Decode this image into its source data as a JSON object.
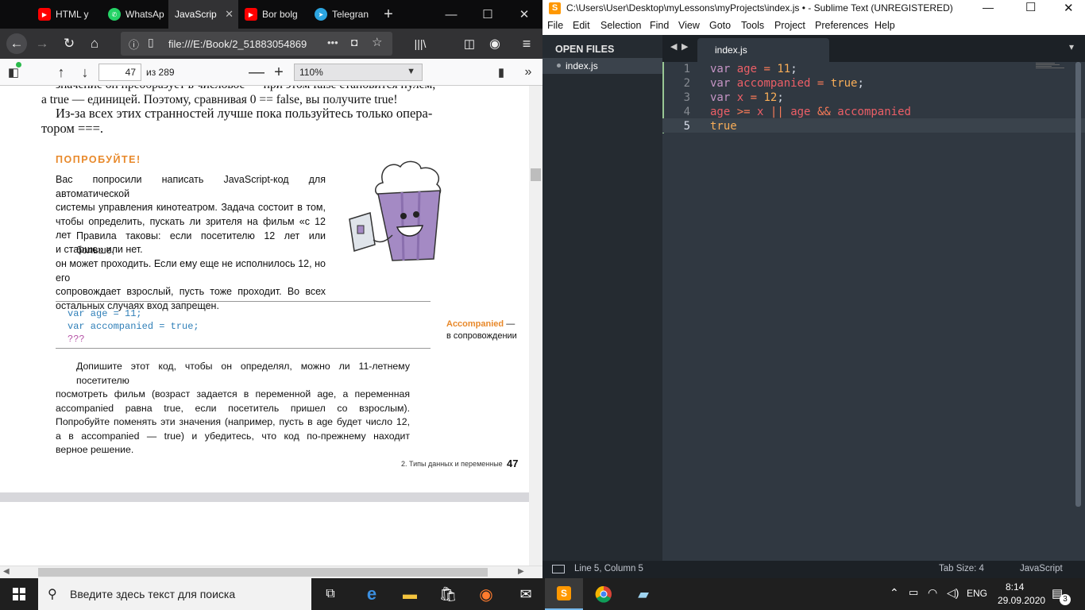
{
  "firefox": {
    "tabs": [
      {
        "label": "HTML у",
        "icon": "youtube-icon",
        "color": "#ff0000"
      },
      {
        "label": "WhatsAp",
        "icon": "whatsapp-icon",
        "color": "#25d366"
      },
      {
        "label": "JavaScrip",
        "icon": "pdf-icon",
        "color": "#888888"
      },
      {
        "label": "Bor bolg",
        "icon": "youtube-icon",
        "color": "#ff0000"
      },
      {
        "label": "Telegran",
        "icon": "telegram-icon",
        "color": "#2ca5e0"
      }
    ],
    "url": "file:///E:/Book/2_51883054869",
    "pdf_toolbar": {
      "page_number": "47",
      "page_total": "из 289",
      "zoom": "110%"
    },
    "page": {
      "top_line_1": "значение он преобразует в числовое — при этом false становится нулем,",
      "top_line_2": "а true — единицей. Поэтому, сравнивая 0 == false, вы получите true!",
      "top_line_3": "Из-за всех этих странностей лучше пока пользуйтесь только опера-",
      "top_line_4": "тором ===.",
      "try_heading": "ПОПРОБУЙТЕ!",
      "task_lines": [
        "Вас попросили написать JavaScript-код для автоматической",
        "системы управления кинотеатром. Задача состоит в том,",
        "чтобы определить, пускать ли зрителя на фильм «с 12 лет",
        "и старше» или нет."
      ],
      "rules_lines": [
        "Правила таковы: если посетителю 12 лет или больше,",
        "он может проходить. Если ему еще не исполнилось 12, но его",
        "сопровождает взрослый, пусть тоже проходит. Во всех",
        "остальных случаях вход запрещен."
      ],
      "code_lines": [
        "var age = 11;",
        "var accompanied = true;",
        "???"
      ],
      "note_term": "Accompanied",
      "note_dash": " —",
      "note_translation": "в сопровождении",
      "finish_lines": [
        "Допишите этот код, чтобы он определял, можно ли 11-летнему посетителю",
        "посмотреть фильм (возраст задается в переменной age, а переменная",
        "accompanied равна true, если посетитель пришел со взрослым).",
        "Попробуйте поменять эти значения (например, пусть в age будет число 12,",
        "а в accompanied — true) и убедитесь, что код по-прежнему находит",
        "верное решение."
      ],
      "footer_chapter": "2. Типы данных и переменные",
      "footer_page": "47"
    }
  },
  "sublime": {
    "title": "C:\\Users\\User\\Desktop\\myLessons\\myProjects\\index.js • - Sublime Text (UNREGISTERED)",
    "menu": [
      "File",
      "Edit",
      "Selection",
      "Find",
      "View",
      "Goto",
      "Tools",
      "Project",
      "Preferences",
      "Help"
    ],
    "sidebar_heading": "OPEN FILES",
    "open_file": "index.js",
    "tab_label": "index.js",
    "line_numbers": [
      "1",
      "2",
      "3",
      "4",
      "5"
    ],
    "code": {
      "l1": {
        "kw": "var",
        "name": "age",
        "eq": "=",
        "num": "11",
        "end": ";"
      },
      "l2": {
        "kw": "var",
        "name": "accompanied",
        "eq": "=",
        "val": "true",
        "end": ";"
      },
      "l3": {
        "kw": "var",
        "name": "x",
        "eq": "=",
        "num": "12",
        "end": ";"
      },
      "l4": {
        "a": "age",
        "op1": ">=",
        "b": "x",
        "op2": "||",
        "c": "age",
        "op3": "&&",
        "d": "accompanied"
      },
      "l5": {
        "val": "true"
      }
    },
    "status": {
      "position": "Line 5, Column 5",
      "tab_size": "Tab Size: 4",
      "syntax": "JavaScript"
    }
  },
  "taskbar": {
    "search_placeholder": "Введите здесь текст для поиска",
    "language": "ENG",
    "time": "8:14",
    "date": "29.09.2020",
    "notifications": "3"
  }
}
